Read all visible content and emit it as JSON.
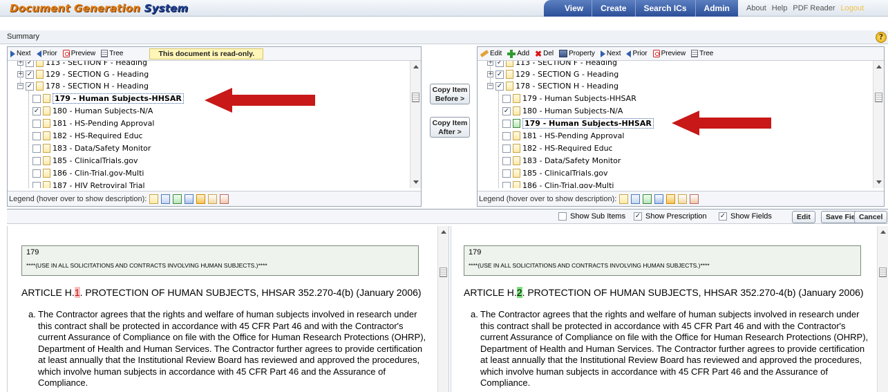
{
  "app": {
    "title_main": "Document Generation",
    "title_sys": "System"
  },
  "nav": {
    "items": [
      "View",
      "Create",
      "Search ICs",
      "Admin"
    ]
  },
  "utility": {
    "items": [
      "About",
      "Help",
      "PDF Reader"
    ],
    "logout": "Logout"
  },
  "summary": {
    "label": "Summary",
    "help": "?"
  },
  "left_panel": {
    "toolbar": {
      "next": "Next",
      "prior": "Prior",
      "preview": "Preview",
      "tree": "Tree"
    },
    "readonly": "This document is read-only.",
    "nodes": [
      "113 - SECTION F - Heading",
      "129 - SECTION G - Heading",
      "178 - SECTION H - Heading",
      "179 - Human Subjects-HHSAR",
      "180 - Human Subjects-N/A",
      "181 - HS-Pending Approval",
      "182 - HS-Required Educ",
      "183 - Data/Safety Monitor",
      "185 - ClinicalTrials.gov",
      "186 - Clin-Trial.gov-Multi",
      "187 - HIV Retroviral Trial"
    ],
    "legend": "Legend (hover over to show description):"
  },
  "right_panel": {
    "toolbar": {
      "edit": "Edit",
      "add": "Add",
      "del": "Del",
      "property": "Property",
      "next": "Next",
      "prior": "Prior",
      "preview": "Preview",
      "tree": "Tree"
    },
    "nodes": [
      "113 - SECTION F - Heading",
      "129 - SECTION G - Heading",
      "178 - SECTION H - Heading",
      "179 - Human Subjects-HHSAR",
      "180 - Human Subjects-N/A",
      "179 - Human Subjects-HHSAR",
      "181 - HS-Pending Approval",
      "182 - HS-Required Educ",
      "183 - Data/Safety Monitor",
      "185 - ClinicalTrials.gov",
      "186 - Clin-Trial.gov-Multi"
    ],
    "legend": "Legend (hover over to show description):"
  },
  "copy": {
    "before_1": "Copy Item",
    "before_2": "Before >",
    "after_1": "Copy Item",
    "after_2": "After >"
  },
  "options": {
    "show_sub_items": "Show Sub Items",
    "show_prescription": "Show Prescription",
    "show_fields": "Show Fields",
    "edit": "Edit",
    "save_fields": "Save Fields",
    "cancel": "Cancel"
  },
  "left_doc": {
    "number": "179",
    "note": "****(USE IN ALL SOLICITATIONS AND CONTRACTS INVOLVING HUMAN SUBJECTS.)****",
    "article_prefix": "ARTICLE H.",
    "article_num": "1",
    "article_suffix": ". PROTECTION OF HUMAN SUBJECTS, HHSAR 352.270-4(b) (January 2006)",
    "para_letter": "a.",
    "para_text": "The Contractor agrees that the rights and welfare of human subjects involved in research under this contract shall be protected in accordance with 45 CFR Part 46 and with the Contractor's current Assurance of Compliance on file with the Office for Human Research Protections (OHRP), Department of Health and Human Services. The Contractor further agrees to provide certification at least annually that the Institutional Review Board has reviewed and approved the procedures, which involve human subjects in accordance with 45 CFR Part 46 and the Assurance of Compliance."
  },
  "right_doc": {
    "number": "179",
    "note": "****(USE IN ALL SOLICITATIONS AND CONTRACTS INVOLVING HUMAN SUBJECTS.)****",
    "article_prefix": "ARTICLE H.",
    "article_num": "2",
    "article_suffix": ". PROTECTION OF HUMAN SUBJECTS, HHSAR 352.270-4(b) (January 2006)",
    "para_letter": "a.",
    "para_text": "The Contractor agrees that the rights and welfare of human subjects involved in research under this contract shall be protected in accordance with 45 CFR Part 46 and with the Contractor's current Assurance of Compliance on file with the Office for Human Research Protections (OHRP), Department of Health and Human Services. The Contractor further agrees to provide certification at least annually that the Institutional Review Board has reviewed and approved the procedures, which involve human subjects in accordance with 45 CFR Part 46 and the Assurance of Compliance."
  },
  "colors": {
    "accent_orange": "#e07b12",
    "nav_blue": "#2c4f99",
    "annotation_red": "#c81818",
    "highlight_green": "#7be07b"
  }
}
